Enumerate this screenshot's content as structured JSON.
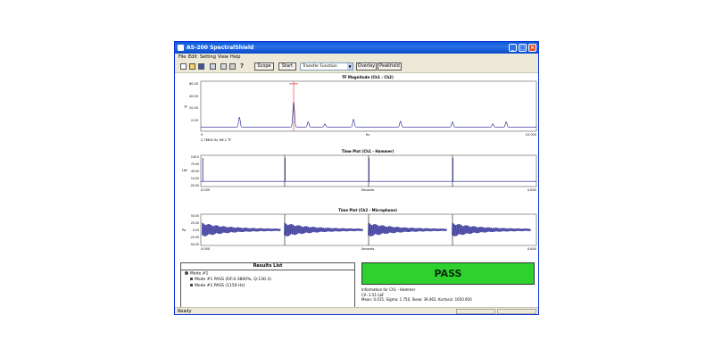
{
  "window": {
    "title": "AS-200 SpectralShield",
    "controls": {
      "minimize": "_",
      "maximize": "□",
      "close": "×"
    }
  },
  "menu": [
    "File",
    "Edit",
    "Setting",
    "View",
    "Help"
  ],
  "toolbar": {
    "scope_label": "Scope",
    "start_label": "Start",
    "mode_value": "Transfer Function",
    "overlay_label": "Overlay",
    "peakhold_label": "Peakhold",
    "icons": [
      "new-icon",
      "open-icon",
      "save-icon",
      "copy-icon",
      "export-icon",
      "print-icon",
      "help-icon"
    ]
  },
  "charts": {
    "tf": {
      "title": "TF Magnitude (Ch1 - Ch2)",
      "ylabel": "TF",
      "xlabel": "Hz",
      "y_ticks": [
        "60.00",
        "40.00",
        "20.00",
        "0.00"
      ],
      "x_ticks": [
        "0",
        "10,000"
      ],
      "cursor_readout": "2,766.8 Hz, 66.1 TF"
    },
    "ch1": {
      "title": "Time Plot (Ch1 - Hammer)",
      "ylabel": "LbF",
      "xlabel": "Seconds",
      "y_ticks": [
        "100.0",
        "70.00",
        "40.00",
        "10.00",
        "-20.00"
      ],
      "x_ticks": [
        "0.000",
        "0.640"
      ]
    },
    "ch2": {
      "title": "Time Plot (Ch2 - Microphone)",
      "ylabel": "Pa",
      "xlabel": "Seconds",
      "y_ticks": [
        "50.00",
        "25.00",
        "0.00",
        "-25.00",
        "-50.00"
      ],
      "x_ticks": [
        "0.000",
        "0.640"
      ]
    }
  },
  "chart_data": [
    {
      "type": "line",
      "title": "TF Magnitude (Ch1 - Ch2)",
      "xlabel": "Hz",
      "ylabel": "TF",
      "xlim": [
        0,
        10000
      ],
      "ylim": [
        -5,
        70
      ],
      "baseline": 1,
      "peaks": [
        {
          "x": 1150,
          "y": 15
        },
        {
          "x": 2767,
          "y": 38
        },
        {
          "x": 3200,
          "y": 8
        },
        {
          "x": 3700,
          "y": 5
        },
        {
          "x": 4550,
          "y": 12
        },
        {
          "x": 5950,
          "y": 9
        },
        {
          "x": 7500,
          "y": 8
        },
        {
          "x": 8700,
          "y": 5
        },
        {
          "x": 9100,
          "y": 8
        }
      ],
      "cursor": {
        "x": 2766.8,
        "y": 66.1
      }
    },
    {
      "type": "line",
      "title": "Time Plot (Ch1 - Hammer)",
      "xlabel": "Seconds",
      "ylabel": "LbF",
      "xlim": [
        0,
        0.64
      ],
      "ylim": [
        -20,
        100
      ],
      "impulses": [
        {
          "x": 0.002,
          "y": 90
        },
        {
          "x": 0.159,
          "y": 90
        },
        {
          "x": 0.319,
          "y": 90
        },
        {
          "x": 0.479,
          "y": 90
        }
      ]
    },
    {
      "type": "line",
      "title": "Time Plot (Ch2 - Microphone)",
      "xlabel": "Seconds",
      "ylabel": "Pa",
      "xlim": [
        0,
        0.64
      ],
      "ylim": [
        -50,
        50
      ],
      "bursts": [
        {
          "x": 0.002,
          "amplitude": 20
        },
        {
          "x": 0.159,
          "amplitude": 20
        },
        {
          "x": 0.319,
          "amplitude": 20
        },
        {
          "x": 0.479,
          "amplitude": 20
        }
      ],
      "decay_duration": 0.15
    }
  ],
  "results": {
    "title": "Results List",
    "items": [
      {
        "label": "Mode #1",
        "level": 0
      },
      {
        "label": "Mode #1 PASS (DF:0.3860%, Q:130.3)",
        "level": 1
      },
      {
        "label": "Mode #1 PASS (1150 Hz)",
        "level": 1
      }
    ]
  },
  "verdict": "PASS",
  "info": {
    "heading": "Information for Ch1 - Hammer",
    "line1": "CA: 2.51 LbF",
    "line2": "Mean: 0.015, Sigma: 1.750, Skew: 39.462, Kurtosis: 1650.950"
  },
  "status": {
    "text": "Ready"
  },
  "colors": {
    "trace": "#1a1a8c",
    "cursor": "#e00000",
    "pass": "#2ed12e",
    "titlebar": "#0a5ad8"
  }
}
